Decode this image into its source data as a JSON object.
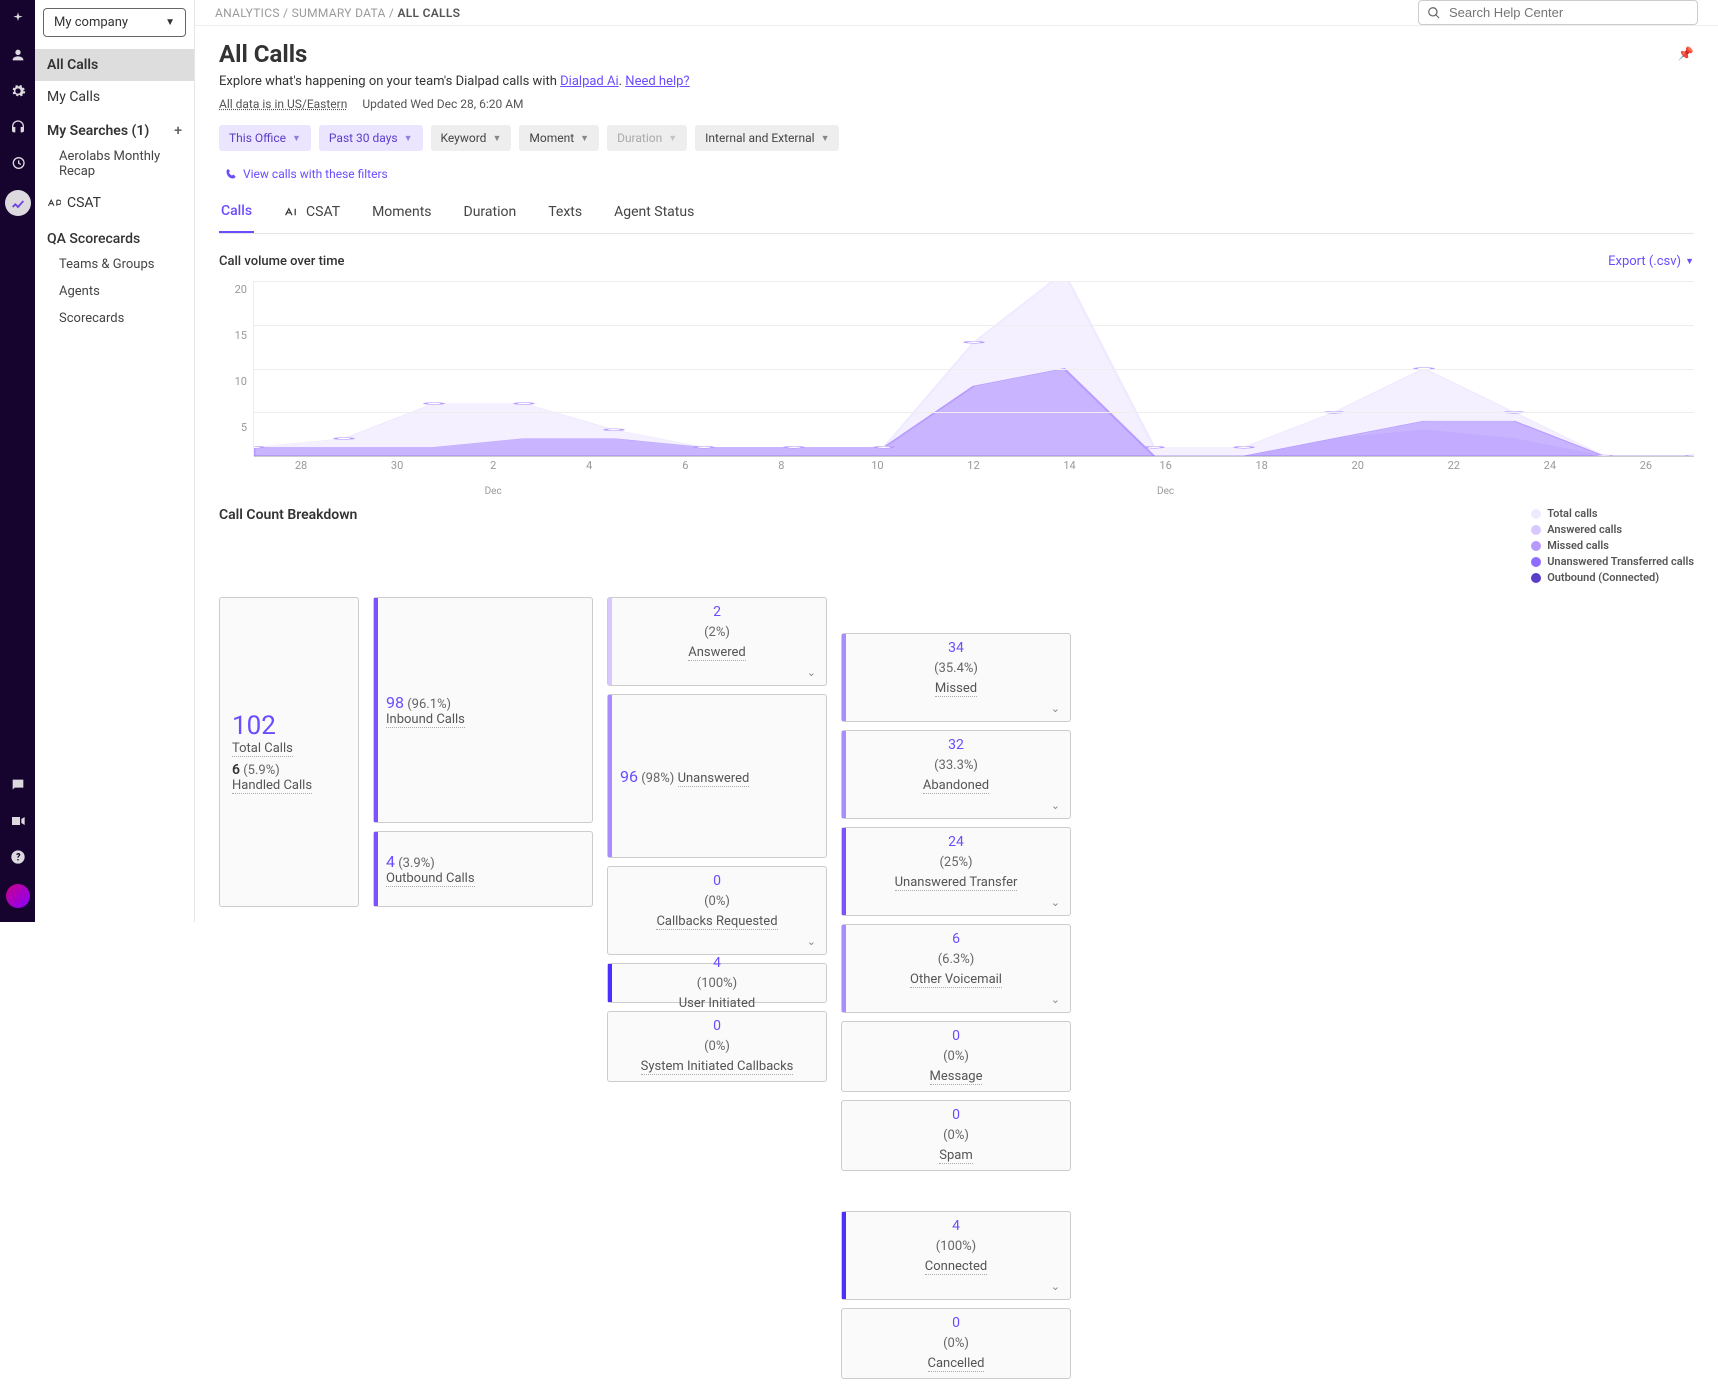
{
  "company": "My company",
  "rail_icons": [
    "sparkle",
    "user",
    "gear",
    "headset",
    "history",
    "chart",
    "chat",
    "video",
    "help"
  ],
  "sidebar": {
    "items": [
      "All Calls",
      "My Calls"
    ],
    "searches_header": "My Searches (1)",
    "searches": [
      "Aerolabs Monthly Recap"
    ],
    "csat": "CSAT",
    "qa_header": "QA Scorecards",
    "qa_items": [
      "Teams & Groups",
      "Agents",
      "Scorecards"
    ]
  },
  "breadcrumbs": [
    "ANALYTICS",
    "SUMMARY DATA",
    "ALL CALLS"
  ],
  "search_placeholder": "Search Help Center",
  "title": "All Calls",
  "subtitle_pre": "Explore what's happening on your team's Dialpad calls with ",
  "subtitle_link1": "Dialpad Ai",
  "subtitle_mid": ". ",
  "subtitle_link2": "Need help?",
  "tz": "All data is in US/Eastern",
  "updated": "Updated Wed Dec 28, 6:20 AM",
  "filters": [
    {
      "label": "This Office",
      "cls": "purple"
    },
    {
      "label": "Past 30 days",
      "cls": "purple"
    },
    {
      "label": "Keyword",
      "cls": "grey"
    },
    {
      "label": "Moment",
      "cls": "grey"
    },
    {
      "label": "Duration",
      "cls": "grey disabled"
    },
    {
      "label": "Internal and External",
      "cls": "grey"
    }
  ],
  "view_calls": "View calls with these filters",
  "tabs": [
    "Calls",
    "CSAT",
    "Moments",
    "Duration",
    "Texts",
    "Agent Status"
  ],
  "chart_title": "Call volume over time",
  "export_label": "Export (.csv)",
  "chart_data": {
    "type": "area",
    "title": "Call volume over time",
    "xlabel": "",
    "ylabel": "",
    "ylim": [
      0,
      20
    ],
    "yticks": [
      20,
      15,
      10,
      5
    ],
    "x": [
      "28",
      "30",
      "2",
      "4",
      "6",
      "8",
      "10",
      "12",
      "14",
      "16",
      "18",
      "20",
      "22",
      "24",
      "26"
    ],
    "month_markers": {
      "2": "Dec",
      "16": "Dec"
    },
    "series": [
      {
        "name": "Total calls",
        "color": "#efeaff",
        "values": [
          1,
          2,
          6,
          6,
          3,
          1,
          1,
          1,
          13,
          21,
          1,
          1,
          5,
          10,
          5,
          0,
          0
        ]
      },
      {
        "name": "Answered calls",
        "color": "#d8c8ff",
        "values": [
          0,
          0,
          0,
          0,
          0,
          0,
          0,
          0,
          0,
          0,
          0,
          0,
          2,
          3,
          2,
          0,
          0
        ]
      },
      {
        "name": "Missed calls",
        "color": "#b79bff",
        "values": [
          1,
          1,
          1,
          2,
          2,
          1,
          1,
          1,
          8,
          10,
          0,
          0,
          2,
          4,
          4,
          0,
          0
        ]
      },
      {
        "name": "Unanswered Transferred calls",
        "color": "#8e6cff",
        "values": [
          0,
          0,
          0,
          0,
          0,
          0,
          0,
          0,
          0,
          0,
          0,
          0,
          0,
          0,
          0,
          0,
          0
        ]
      },
      {
        "name": "Outbound (Connected)",
        "color": "#5a3ec8",
        "values": [
          0,
          0,
          0,
          0,
          0,
          0,
          0,
          0,
          0,
          0,
          0,
          0,
          0,
          0,
          0,
          0,
          0
        ]
      }
    ]
  },
  "breakdown_title": "Call Count Breakdown",
  "legend": [
    {
      "label": "Total calls",
      "color": "#efeaff"
    },
    {
      "label": "Answered calls",
      "color": "#d8c8ff"
    },
    {
      "label": "Missed calls",
      "color": "#b79bff"
    },
    {
      "label": "Unanswered Transferred calls",
      "color": "#8e6cff"
    },
    {
      "label": "Outbound (Connected)",
      "color": "#5a3ec8"
    }
  ],
  "bd": {
    "total": {
      "n": "102",
      "label": "Total Calls",
      "h_n": "6",
      "h_pct": "(5.9%)",
      "h_label": "Handled Calls"
    },
    "inbound": {
      "n": "98",
      "pct": "(96.1%)",
      "label": "Inbound Calls"
    },
    "outbound": {
      "n": "4",
      "pct": "(3.9%)",
      "label": "Outbound Calls"
    },
    "answered": {
      "n": "2",
      "pct": "(2%)",
      "label": "Answered"
    },
    "unanswered": {
      "n": "96",
      "pct": "(98%)",
      "label": "Unanswered"
    },
    "callbacks_req": {
      "n": "0",
      "pct": "(0%)",
      "label": "Callbacks Requested"
    },
    "user_init": {
      "n": "4",
      "pct": "(100%)",
      "label": "User Initiated"
    },
    "sys_init": {
      "n": "0",
      "pct": "(0%)",
      "label": "System Initiated Callbacks"
    },
    "missed": {
      "n": "34",
      "pct": "(35.4%)",
      "label": "Missed"
    },
    "abandoned": {
      "n": "32",
      "pct": "(33.3%)",
      "label": "Abandoned"
    },
    "un_transfer": {
      "n": "24",
      "pct": "(25%)",
      "label": "Unanswered Transfer"
    },
    "other_vm": {
      "n": "6",
      "pct": "(6.3%)",
      "label": "Other Voicemail"
    },
    "message": {
      "n": "0",
      "pct": "(0%)",
      "label": "Message"
    },
    "spam": {
      "n": "0",
      "pct": "(0%)",
      "label": "Spam"
    },
    "connected": {
      "n": "4",
      "pct": "(100%)",
      "label": "Connected"
    },
    "cancelled": {
      "n": "0",
      "pct": "(0%)",
      "label": "Cancelled"
    }
  }
}
